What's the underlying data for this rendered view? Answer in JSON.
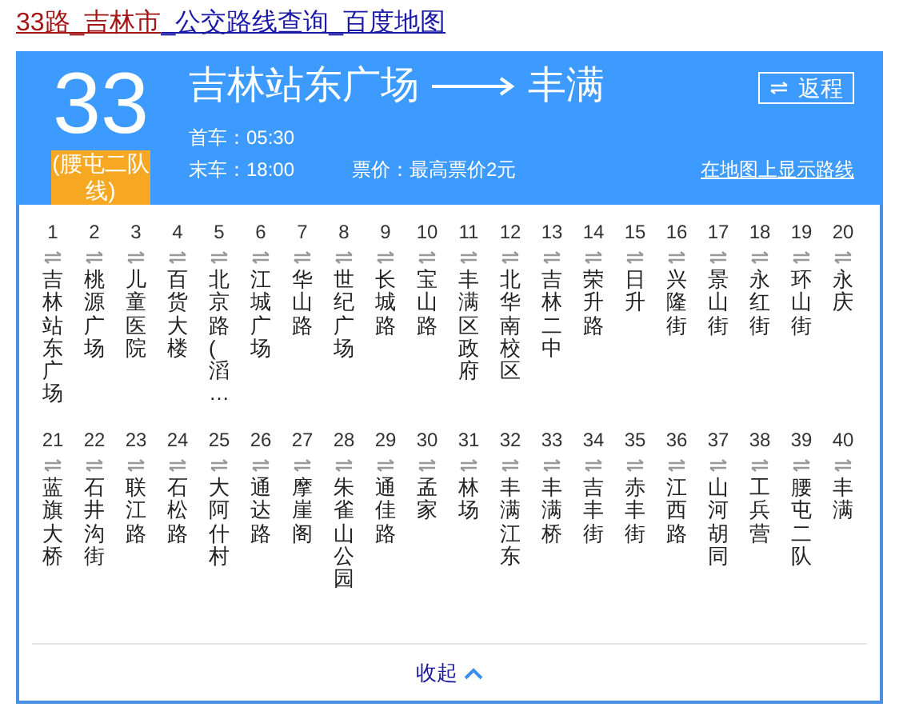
{
  "page_title": [
    {
      "text": "33路_吉林市",
      "visited": true
    },
    {
      "text": "_公交路线查询_百度地图",
      "visited": false
    }
  ],
  "route": {
    "number": "33",
    "alias": "(腰屯二队线)",
    "from": "吉林站东广场",
    "to": "丰满",
    "first_bus_label": "首车：",
    "first_bus": "05:30",
    "last_bus_label": "末车：",
    "last_bus": "18:00",
    "fare_label": "票价：",
    "fare": "最高票价2元",
    "return_button": "返程",
    "map_link": "在地图上显示路线"
  },
  "stops": [
    {
      "num": "1",
      "name": "吉林站东广场"
    },
    {
      "num": "2",
      "name": "桃源广场"
    },
    {
      "num": "3",
      "name": "儿童医院"
    },
    {
      "num": "4",
      "name": "百货大楼"
    },
    {
      "num": "5",
      "name": "北京路(滔…"
    },
    {
      "num": "6",
      "name": "江城广场"
    },
    {
      "num": "7",
      "name": "华山路"
    },
    {
      "num": "8",
      "name": "世纪广场"
    },
    {
      "num": "9",
      "name": "长城路"
    },
    {
      "num": "10",
      "name": "宝山路"
    },
    {
      "num": "11",
      "name": "丰满区政府"
    },
    {
      "num": "12",
      "name": "北华南校区"
    },
    {
      "num": "13",
      "name": "吉林二中"
    },
    {
      "num": "14",
      "name": "荣升路"
    },
    {
      "num": "15",
      "name": "日升"
    },
    {
      "num": "16",
      "name": "兴隆街"
    },
    {
      "num": "17",
      "name": "景山街"
    },
    {
      "num": "18",
      "name": "永红街"
    },
    {
      "num": "19",
      "name": "环山街"
    },
    {
      "num": "20",
      "name": "永庆"
    },
    {
      "num": "21",
      "name": "蓝旗大桥"
    },
    {
      "num": "22",
      "name": "石井沟街"
    },
    {
      "num": "23",
      "name": "联江路"
    },
    {
      "num": "24",
      "name": "石松路"
    },
    {
      "num": "25",
      "name": "大阿什村"
    },
    {
      "num": "26",
      "name": "通达路"
    },
    {
      "num": "27",
      "name": "摩崖阁"
    },
    {
      "num": "28",
      "name": "朱雀山公园"
    },
    {
      "num": "29",
      "name": "通佳路"
    },
    {
      "num": "30",
      "name": "孟家"
    },
    {
      "num": "31",
      "name": "林场"
    },
    {
      "num": "32",
      "name": "丰满江东"
    },
    {
      "num": "33",
      "name": "丰满桥"
    },
    {
      "num": "34",
      "name": "吉丰街"
    },
    {
      "num": "35",
      "name": "赤丰街"
    },
    {
      "num": "36",
      "name": "江西路"
    },
    {
      "num": "37",
      "name": "山河胡同"
    },
    {
      "num": "38",
      "name": "工兵营"
    },
    {
      "num": "39",
      "name": "腰屯二队"
    },
    {
      "num": "40",
      "name": "丰满"
    }
  ],
  "collapse_link": "收起"
}
